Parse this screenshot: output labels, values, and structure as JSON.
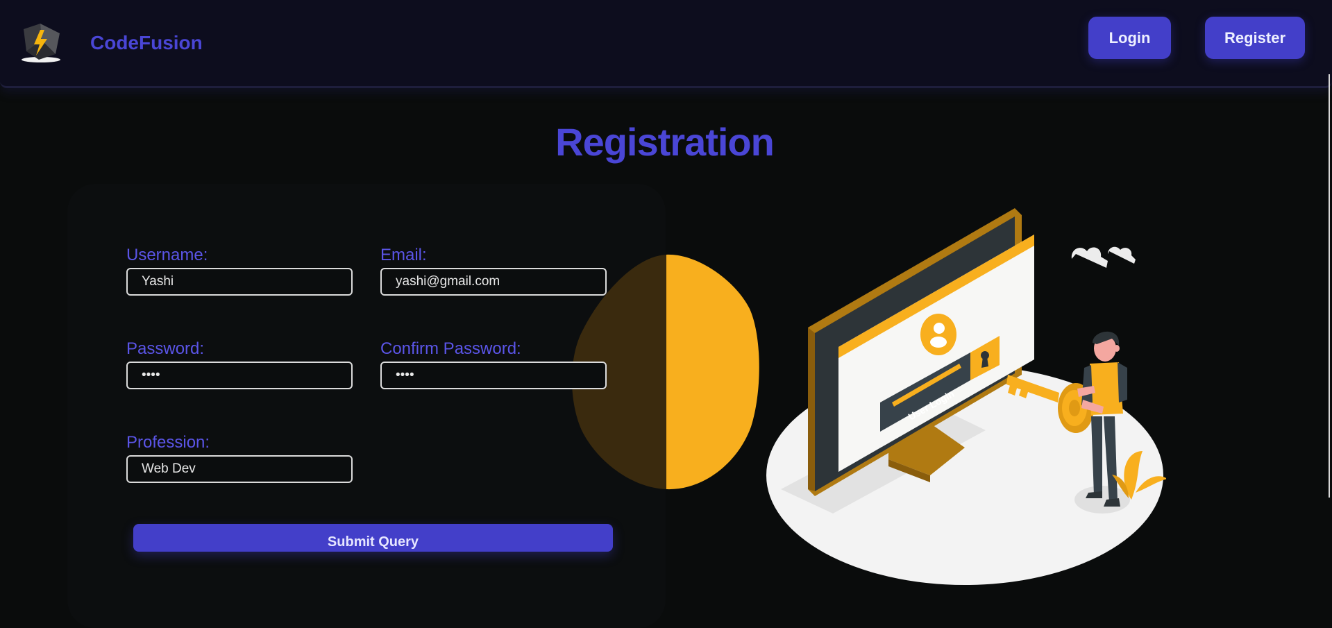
{
  "navbar": {
    "brand_name": "CodeFusion",
    "logo_icon": "lightning-bolt-logo-icon",
    "login_label": "Login",
    "register_label": "Register"
  },
  "page": {
    "title": "Registration"
  },
  "form": {
    "username": {
      "label": "Username:",
      "value": "Yashi"
    },
    "email": {
      "label": "Email:",
      "value": "yashi@gmail.com"
    },
    "password": {
      "label": "Password:",
      "value": "abcd"
    },
    "confirm_password": {
      "label": "Confirm Password:",
      "value": "abcd"
    },
    "profession": {
      "label": "Profession:",
      "value": "Web Dev"
    },
    "submit_label": "Submit Query"
  },
  "illustration": {
    "screen_text": "User Login"
  },
  "colors": {
    "accent": "#433fc9",
    "accent_text": "#4a46d6",
    "label": "#5b55e8",
    "illustration_yellow": "#f8af1e",
    "background": "#0a0c0c",
    "navbar": "#0d0d1e"
  }
}
